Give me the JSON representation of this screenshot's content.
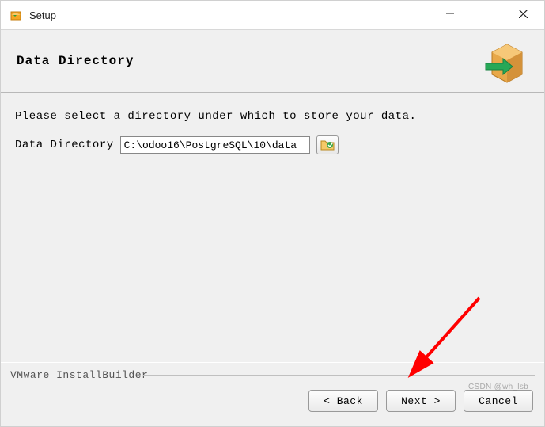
{
  "window": {
    "title": "Setup"
  },
  "header": {
    "title": "Data Directory"
  },
  "content": {
    "instruction": "Please select a directory under which to store your data.",
    "field_label": "Data Directory",
    "path_value": "C:\\odoo16\\PostgreSQL\\10\\data"
  },
  "footer": {
    "brand": "VMware InstallBuilder",
    "back_label": "< Back",
    "next_label": "Next >",
    "cancel_label": "Cancel"
  },
  "watermark": "CSDN @wh_lsb"
}
